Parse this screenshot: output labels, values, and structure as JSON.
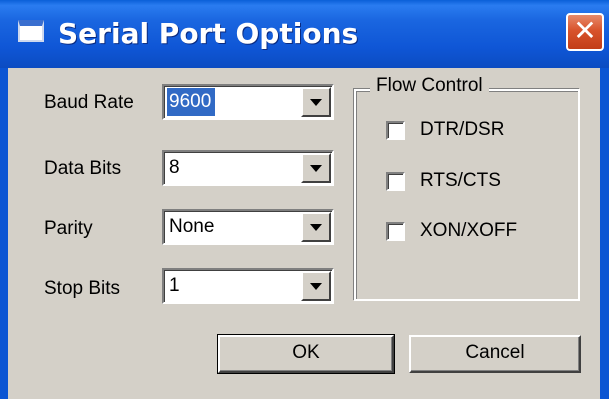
{
  "window": {
    "title": "Serial Port Options",
    "close_glyph": "✕",
    "icon": "window-icon"
  },
  "fields": {
    "baud_rate": {
      "label": "Baud Rate",
      "value": "9600"
    },
    "data_bits": {
      "label": "Data Bits",
      "value": "8"
    },
    "parity": {
      "label": "Parity",
      "value": "None"
    },
    "stop_bits": {
      "label": "Stop Bits",
      "value": "1"
    }
  },
  "flow_control": {
    "title": "Flow Control",
    "options": [
      {
        "label": "DTR/DSR",
        "checked": false
      },
      {
        "label": "RTS/CTS",
        "checked": false
      },
      {
        "label": "XON/XOFF",
        "checked": false
      }
    ]
  },
  "buttons": {
    "ok": "OK",
    "cancel": "Cancel"
  },
  "colors": {
    "titlebar": "#0b55d3",
    "dialog_bg": "#d4d0c8",
    "selection": "#316ac5",
    "close_button": "#d8532c"
  }
}
